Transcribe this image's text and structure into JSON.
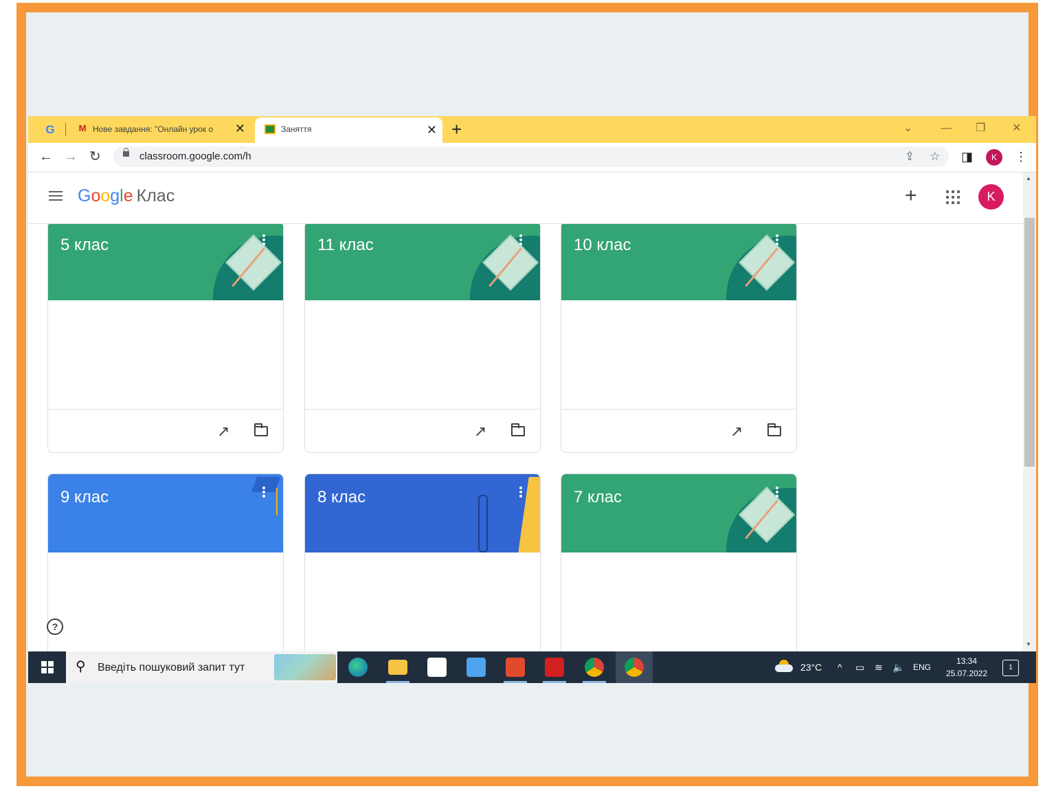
{
  "browser": {
    "tabs": [
      {
        "title": "Нове завдання: \"Онлайн урок о",
        "icon": "gmail-icon"
      },
      {
        "title": "Заняття",
        "icon": "classroom-icon"
      }
    ],
    "url": "classroom.google.com/h",
    "profile_initial": "K"
  },
  "app": {
    "logo_google": "Google",
    "product": "Клас",
    "avatar_initial": "K"
  },
  "classes": [
    {
      "name": "5 клас",
      "color": "#33a474",
      "theme": "book"
    },
    {
      "name": "11 клас",
      "color": "#33a474",
      "theme": "book"
    },
    {
      "name": "10 клас",
      "color": "#33a474",
      "theme": "book"
    },
    {
      "name": "9 клас",
      "color": "#3a82e8",
      "theme": "graduation"
    },
    {
      "name": "8 клас",
      "color": "#3166d3",
      "theme": "headphones"
    },
    {
      "name": "7 клас",
      "color": "#33a474",
      "theme": "book"
    }
  ],
  "taskbar": {
    "search_placeholder": "Введіть пошуковий запит тут",
    "temperature": "23°C",
    "language": "ENG",
    "time": "13:34",
    "date": "25.07.2022",
    "notifications": "1"
  }
}
